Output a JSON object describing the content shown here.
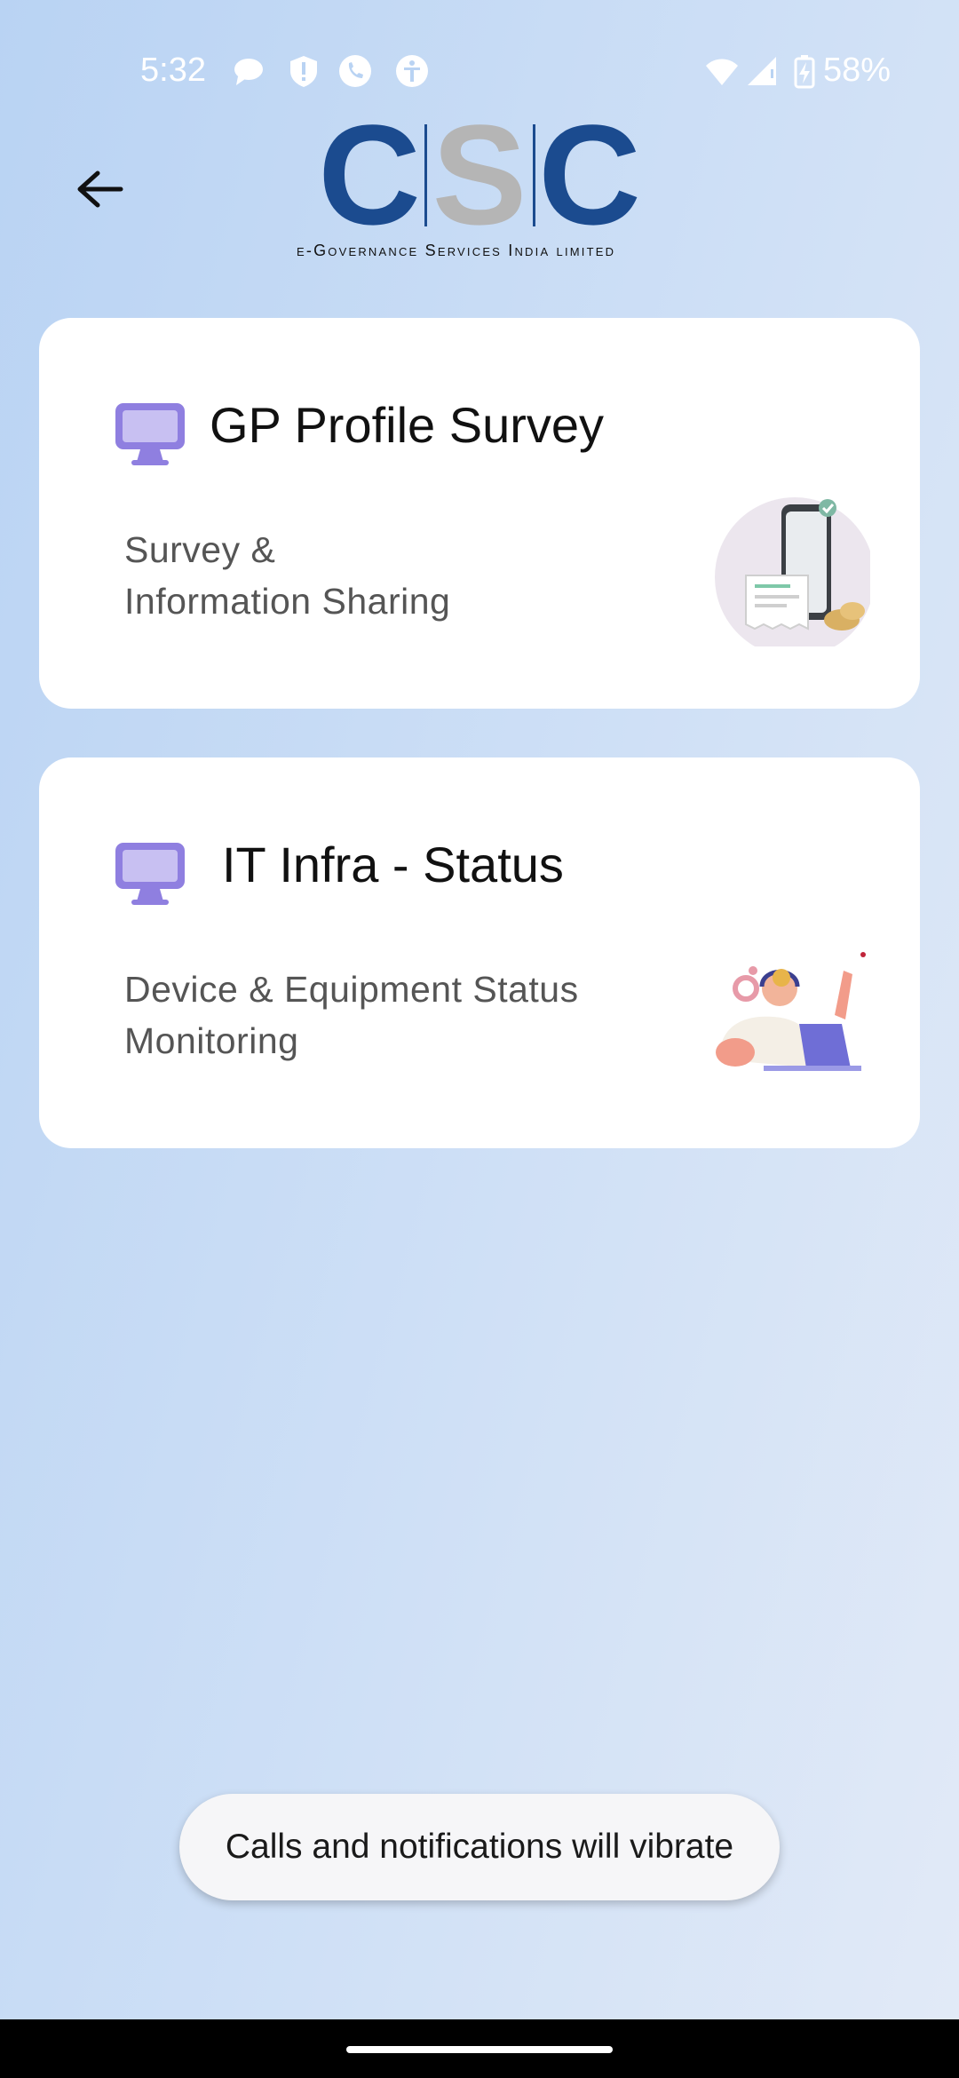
{
  "status_bar": {
    "time": "5:32",
    "battery": "58%",
    "left_icons": [
      "chat-bubble-icon",
      "shield-alert-icon",
      "phone-icon",
      "accessibility-icon"
    ],
    "right_icons": [
      "wifi-icon",
      "signal-icon",
      "battery-charging-icon"
    ]
  },
  "header": {
    "back_icon": "arrow-left-icon",
    "logo_text": "CSC",
    "logo_subtitle": "e-Governance Services India limited",
    "logo_colors": {
      "primary": "#1b4b8f",
      "secondary": "#b5b5b5"
    }
  },
  "cards": [
    {
      "title": "GP Profile Survey",
      "description": "Survey &\nInformation Sharing",
      "icon": "monitor-icon",
      "illustration": "phone-receipt-illustration"
    },
    {
      "title": "IT Infra - Status",
      "description": "Device & Equipment  Status\nMonitoring",
      "icon": "monitor-icon",
      "illustration": "support-agent-illustration"
    }
  ],
  "toast": {
    "message": "Calls and notifications will vibrate"
  },
  "colors": {
    "monitor_icon": "#8f7fe0",
    "card_background": "#ffffff",
    "toast_background": "#f6f6f8"
  }
}
